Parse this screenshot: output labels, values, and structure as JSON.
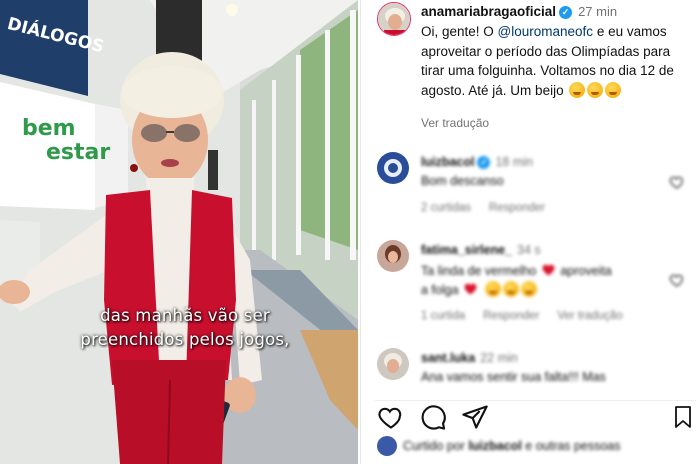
{
  "video": {
    "sign_top": "DIÁLOGOS",
    "sign_logo_line1": "bem",
    "sign_logo_line2": "estar",
    "caption_line1": "das manhãs vão ser",
    "caption_line2": "preenchidos pelos jogos,"
  },
  "post": {
    "username": "anamariabragaoficial",
    "time": "27 min",
    "text_before_mention": "Oi, gente! O ",
    "mention": "@louromaneofc",
    "text_after_mention": " e eu vamos aproveitar o período das Olimpíadas para tirar uma folguinha. Voltamos no dia 12 de agosto. Até já. Um beijo",
    "see_translation": "Ver tradução"
  },
  "comments": [
    {
      "username": "luizbacol",
      "time": "18 min",
      "text": "Bom descanso",
      "meta": [
        "2 curtidas",
        "Responder"
      ]
    },
    {
      "username": "fatima_sirlene_",
      "time": "34 s",
      "text_before": "Ta linda de vermelho",
      "text_mid": "aproveita",
      "text_after": "a folga",
      "meta": [
        "1 curtida",
        "Responder",
        "Ver tradução"
      ]
    },
    {
      "username": "sant.luka",
      "time": "22 min",
      "text": "Ana vamos sentir sua falta!!! Mas"
    }
  ],
  "footer": {
    "liked_by_prefix": "Curtido por ",
    "liked_by_user": "luizbacol",
    "liked_by_suffix": " e outras pessoas"
  },
  "icons": [
    "heart-icon",
    "comment-icon",
    "share-icon",
    "bookmark-icon",
    "verified-icon"
  ],
  "colors": {
    "accent_blue": "#1d9bf0",
    "mention": "#00376b",
    "meta_gray": "#737373",
    "vest_red": "#c8102e"
  }
}
